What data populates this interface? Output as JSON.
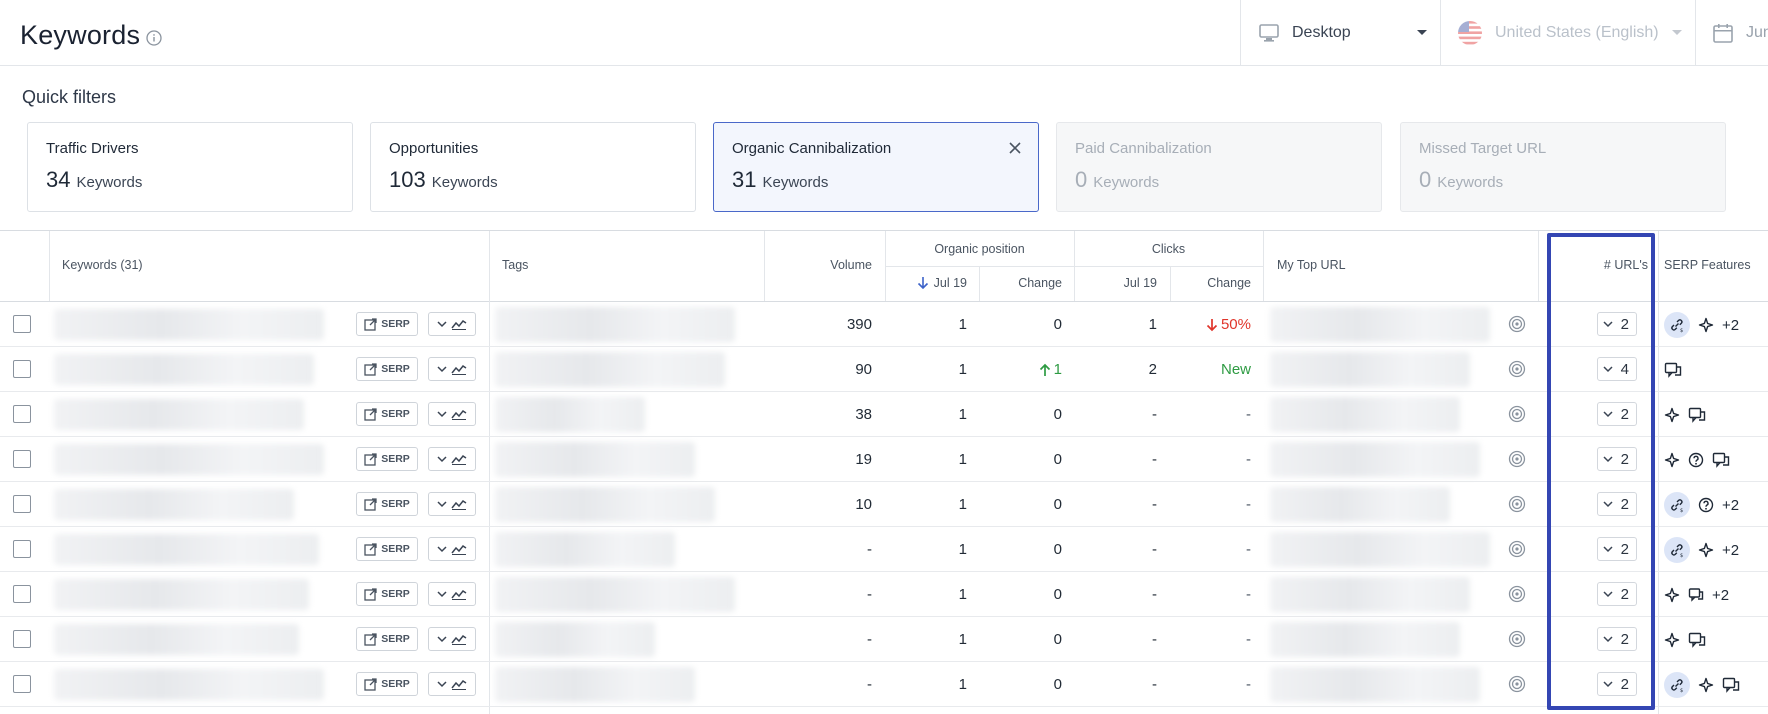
{
  "header": {
    "title": "Keywords",
    "device": "Desktop",
    "locale": "United States (English)",
    "date": "Jun"
  },
  "quick_filters": {
    "title": "Quick filters",
    "cards": [
      {
        "name": "Traffic Drivers",
        "count": "34",
        "unit": "Keywords",
        "state": "normal"
      },
      {
        "name": "Opportunities",
        "count": "103",
        "unit": "Keywords",
        "state": "normal"
      },
      {
        "name": "Organic Cannibalization",
        "count": "31",
        "unit": "Keywords",
        "state": "active"
      },
      {
        "name": "Paid Cannibalization",
        "count": "0",
        "unit": "Keywords",
        "state": "disabled"
      },
      {
        "name": "Missed Target URL",
        "count": "0",
        "unit": "Keywords",
        "state": "disabled"
      }
    ]
  },
  "table": {
    "headers": {
      "keywords": "Keywords (31)",
      "tags": "Tags",
      "volume": "Volume",
      "organic_position": "Organic position",
      "pos_date": "Jul 19",
      "pos_change": "Change",
      "clicks": "Clicks",
      "clicks_date": "Jul 19",
      "clicks_change": "Change",
      "top_url": "My Top URL",
      "urls": "# URL's",
      "serp_features": "SERP Features"
    },
    "serp_button": "SERP",
    "rows": [
      {
        "volume": "390",
        "position": "1",
        "pos_change": "0",
        "pos_dir": "none",
        "clicks": "1",
        "clicks_change": "50%",
        "clicks_dir": "down",
        "urls": "2",
        "features": [
          "link",
          "sparkle"
        ],
        "more": "+2"
      },
      {
        "volume": "90",
        "position": "1",
        "pos_change": "1",
        "pos_dir": "up",
        "clicks": "2",
        "clicks_change": "New",
        "clicks_dir": "new",
        "urls": "4",
        "features": [
          "review"
        ],
        "more": ""
      },
      {
        "volume": "38",
        "position": "1",
        "pos_change": "0",
        "pos_dir": "none",
        "clicks": "-",
        "clicks_change": "-",
        "clicks_dir": "none",
        "urls": "2",
        "features": [
          "sparkle",
          "review"
        ],
        "more": ""
      },
      {
        "volume": "19",
        "position": "1",
        "pos_change": "0",
        "pos_dir": "none",
        "clicks": "-",
        "clicks_change": "-",
        "clicks_dir": "none",
        "urls": "2",
        "features": [
          "sparkle",
          "question",
          "review"
        ],
        "more": ""
      },
      {
        "volume": "10",
        "position": "1",
        "pos_change": "0",
        "pos_dir": "none",
        "clicks": "-",
        "clicks_change": "-",
        "clicks_dir": "none",
        "urls": "2",
        "features": [
          "link",
          "question"
        ],
        "more": "+2"
      },
      {
        "volume": "-",
        "position": "1",
        "pos_change": "0",
        "pos_dir": "none",
        "clicks": "-",
        "clicks_change": "-",
        "clicks_dir": "none",
        "urls": "2",
        "features": [
          "link",
          "sparkle"
        ],
        "more": "+2"
      },
      {
        "volume": "-",
        "position": "1",
        "pos_change": "0",
        "pos_dir": "none",
        "clicks": "-",
        "clicks_change": "-",
        "clicks_dir": "none",
        "urls": "2",
        "features": [
          "sparkle",
          "chat"
        ],
        "more": "+2"
      },
      {
        "volume": "-",
        "position": "1",
        "pos_change": "0",
        "pos_dir": "none",
        "clicks": "-",
        "clicks_change": "-",
        "clicks_dir": "none",
        "urls": "2",
        "features": [
          "sparkle",
          "review"
        ],
        "more": ""
      },
      {
        "volume": "-",
        "position": "1",
        "pos_change": "0",
        "pos_dir": "none",
        "clicks": "-",
        "clicks_change": "-",
        "clicks_dir": "none",
        "urls": "2",
        "features": [
          "link",
          "sparkle",
          "review"
        ],
        "more": ""
      }
    ]
  },
  "colors": {
    "accent": "#4a68c9",
    "highlight": "#3446b3",
    "up": "#2e9b43",
    "down": "#e0352b"
  }
}
